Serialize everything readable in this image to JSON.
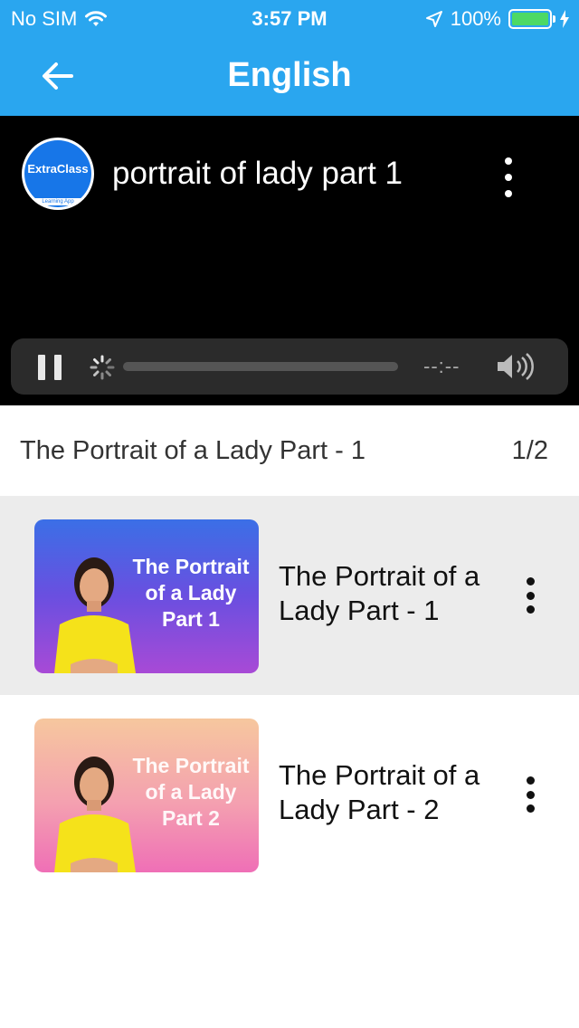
{
  "status_bar": {
    "carrier": "No SIM",
    "time": "3:57 PM",
    "battery": "100%"
  },
  "nav": {
    "title": "English"
  },
  "player": {
    "channel_logo_text": "ExtraClass",
    "channel_logo_tagline": "Learning App",
    "video_title": "portrait of lady part 1",
    "time_display": "--:--"
  },
  "playlist": {
    "title": "The Portrait of a Lady Part - 1",
    "position": "1/2",
    "items": [
      {
        "thumb_lines": [
          "The Portrait",
          "of a Lady",
          "Part 1"
        ],
        "label": "The Portrait of a Lady Part - 1",
        "active": true
      },
      {
        "thumb_lines": [
          "The Portrait",
          "of a Lady",
          "Part 2"
        ],
        "label": "The Portrait of a Lady Part - 2",
        "active": false
      }
    ]
  },
  "colors": {
    "header_blue": "#2aa6ef",
    "battery_green": "#4cd964",
    "active_row": "#ececec"
  }
}
